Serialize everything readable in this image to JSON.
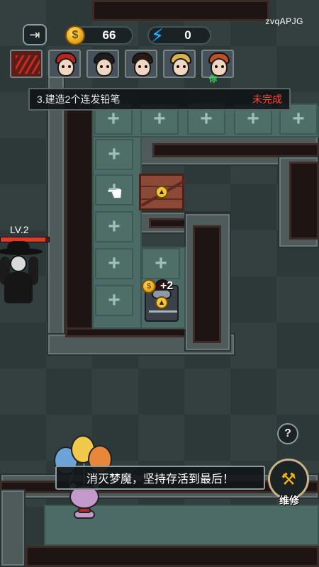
{
  "hud": {
    "coins": "66",
    "energy": "0",
    "server_code": "zvqAPJG"
  },
  "roster": {
    "you_label": "你",
    "players": [
      {
        "name": "slot-1",
        "hair_color": "#b7261e"
      },
      {
        "name": "slot-2",
        "hair_color": "#1d1d1d"
      },
      {
        "name": "slot-3",
        "hair_color": "#2b1a12"
      },
      {
        "name": "slot-4",
        "hair_color": "#d8b24a"
      },
      {
        "name": "slot-5",
        "hair_color": "#c0502a"
      },
      {
        "name": "slot-6",
        "hair_color": "#5a1a12"
      }
    ]
  },
  "quest": {
    "text": "3.建造2个连发铅笔",
    "status": "未完成",
    "status_color": "#ff4a3a"
  },
  "bed": {
    "income": "+2"
  },
  "enemy": {
    "level": "LV.2",
    "hp_fraction": 0.92
  },
  "controls": {
    "help_symbol": "?",
    "repair_label": "维修"
  },
  "tip": {
    "text": "消灭梦魔，坚持存活到最后！"
  },
  "colors": {
    "accent_gold": "#f2c53a",
    "energy_blue": "#2fb3ff",
    "enemy_hp_red": "#e03a26",
    "you_green": "#3ee05a"
  }
}
